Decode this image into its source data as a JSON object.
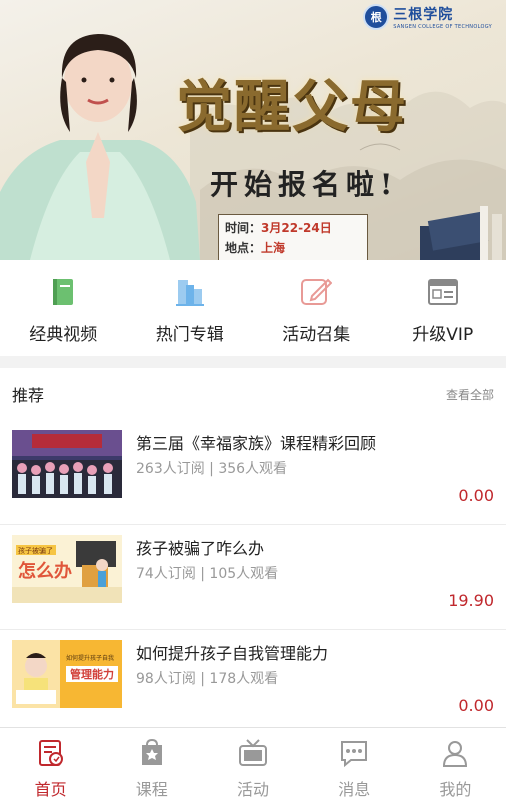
{
  "banner": {
    "logo_seal": "根",
    "logo_name": "三根学院",
    "logo_sub": "SANGEN COLLEGE OF TECHNOLOGY",
    "title": "觉醒父母",
    "subtitle": "开始报名啦!",
    "time_label": "时间：",
    "time_value": "3月22-24日",
    "place_label": "地点：",
    "place_value": "上海"
  },
  "quick_menu": [
    {
      "label": "经典视频",
      "icon": "book-icon",
      "color": "#5cb85c"
    },
    {
      "label": "热门专辑",
      "icon": "album-icon",
      "color": "#5aa9e6"
    },
    {
      "label": "活动召集",
      "icon": "edit-icon",
      "color": "#e89a96"
    },
    {
      "label": "升级VIP",
      "icon": "vip-card-icon",
      "color": "#888888"
    }
  ],
  "recommend": {
    "title": "推荐",
    "more": "查看全部",
    "items": [
      {
        "title": "第三届《幸福家族》课程精彩回顾",
        "meta": "263人订阅 | 356人观看",
        "price": "0.00"
      },
      {
        "title": "孩子被骗了咋么办",
        "meta": "74人订阅 | 105人观看",
        "price": "19.90",
        "thumb_text": "怎么办",
        "thumb_tag": "孩子被骗了"
      },
      {
        "title": "如何提升孩子自我管理能力",
        "meta": "98人订阅 | 178人观看",
        "price": "0.00",
        "thumb_text": "管理能力",
        "thumb_tag": "如何提升孩子自我"
      }
    ]
  },
  "tabbar": [
    {
      "label": "首页",
      "icon": "home-icon",
      "active": true
    },
    {
      "label": "课程",
      "icon": "course-bag-icon",
      "active": false
    },
    {
      "label": "活动",
      "icon": "tv-icon",
      "active": false
    },
    {
      "label": "消息",
      "icon": "message-icon",
      "active": false
    },
    {
      "label": "我的",
      "icon": "profile-icon",
      "active": false
    }
  ],
  "colors": {
    "accent": "#c0282d",
    "muted": "#999999",
    "title_gold": "#8a6a2e"
  }
}
